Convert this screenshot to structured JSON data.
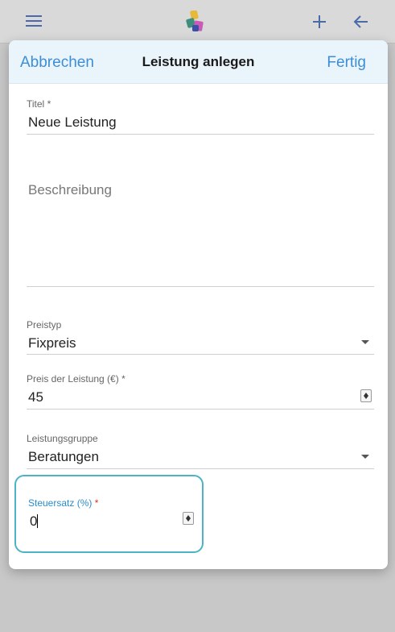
{
  "modal": {
    "cancel_label": "Abbrechen",
    "title": "Leistung anlegen",
    "done_label": "Fertig"
  },
  "fields": {
    "title": {
      "label": "Titel",
      "required_mark": "*",
      "value": "Neue Leistung"
    },
    "description": {
      "placeholder": "Beschreibung"
    },
    "price_type": {
      "label": "Preistyp",
      "value": "Fixpreis"
    },
    "price": {
      "label": "Preis der Leistung (€)",
      "required_mark": "*",
      "value": "45"
    },
    "group": {
      "label": "Leistungsgruppe",
      "value": "Beratungen"
    },
    "tax_rate": {
      "label": "Steuersatz (%)",
      "required_mark": "*",
      "value": "0"
    }
  },
  "colors": {
    "accent": "#3d8ed8",
    "focus": "#4bb3c4",
    "required": "#d9312a"
  }
}
